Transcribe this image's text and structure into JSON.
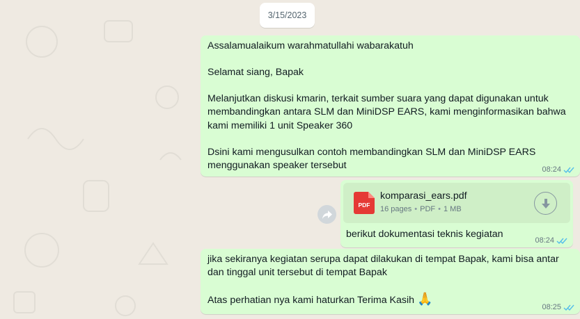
{
  "date_chip": "3/15/2023",
  "messages": [
    {
      "lines": [
        "Assalamualaikum warahmatullahi wabarakatuh",
        "",
        "Selamat siang, Bapak",
        "",
        "Melanjutkan diskusi kmarin, terkait sumber suara yang dapat digunakan untuk membandingkan antara SLM dan MiniDSP EARS, kami menginformasikan bahwa kami memiliki 1 unit Speaker 360",
        "",
        "Dsini kami mengusulkan contoh membandingkan SLM dan MiniDSP EARS menggunakan speaker tersebut"
      ],
      "time": "08:24",
      "status_icon": "double-check-read-icon"
    },
    {
      "document": {
        "badge": "PDF",
        "name": "komparasi_ears.pdf",
        "pages": "16 pages",
        "type": "PDF",
        "size": "1 MB",
        "download_icon": "download-icon"
      },
      "caption": "berikut dokumentasi teknis kegiatan",
      "time": "08:24",
      "status_icon": "double-check-read-icon"
    },
    {
      "text_1": "jika sekiranya kegiatan serupa dapat dilakukan di tempat Bapak, kami bisa antar dan tinggal unit tersebut di tempat Bapak",
      "text_2": "Atas perhatian nya kami haturkan Terima Kasih",
      "emoji": "🙏",
      "time": "08:25",
      "status_icon": "double-check-read-icon"
    }
  ],
  "forward_icon": "forward-icon",
  "colors": {
    "background": "#efeae2",
    "outgoing_bubble": "#d9fdd3",
    "read_ticks": "#53bdeb",
    "pdf_red": "#e53935"
  }
}
